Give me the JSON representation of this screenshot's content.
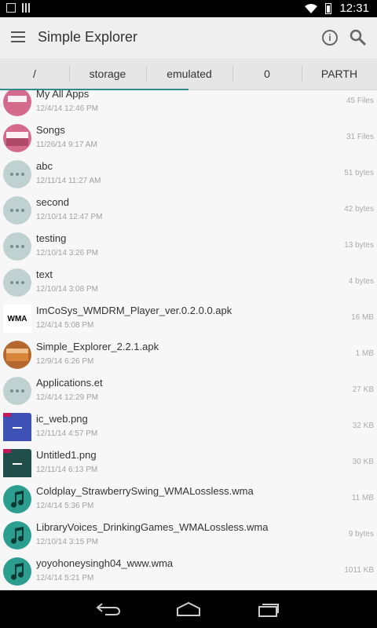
{
  "status_bar": {
    "time": "12:31"
  },
  "app_bar": {
    "title": "Simple Explorer"
  },
  "breadcrumbs": [
    {
      "label": "/",
      "active": true
    },
    {
      "label": "storage"
    },
    {
      "label": "emulated"
    },
    {
      "label": "0"
    },
    {
      "label": "PARTH"
    }
  ],
  "files": [
    {
      "name": "My All Apps",
      "date": "12/4/14 12:46 PM",
      "size": "45 Files",
      "icon": "folder-icon",
      "color": "#d56b8c"
    },
    {
      "name": "Songs",
      "date": "11/26/14 9:17 AM",
      "size": "31 Files",
      "icon": "folder-icon",
      "color": "#d56b8c"
    },
    {
      "name": "abc",
      "date": "12/11/14 11:27 AM",
      "size": "51 bytes",
      "icon": "file-generic-icon",
      "color": "#bfd1d1"
    },
    {
      "name": "second",
      "date": "12/10/14 12:47 PM",
      "size": "42 bytes",
      "icon": "file-generic-icon",
      "color": "#bfd1d1"
    },
    {
      "name": "testing",
      "date": "12/10/14 3:26 PM",
      "size": "13 bytes",
      "icon": "file-generic-icon",
      "color": "#bfd1d1"
    },
    {
      "name": "text",
      "date": "12/10/14 3:08 PM",
      "size": "4 bytes",
      "icon": "file-generic-icon",
      "color": "#bfd1d1"
    },
    {
      "name": "ImCoSys_WMDRM_Player_ver.0.2.0.0.apk",
      "date": "12/4/14 5:08 PM",
      "size": "16 MB",
      "icon": "wma-logo-icon",
      "color": "#ffffff",
      "logo_text": "WMA"
    },
    {
      "name": "Simple_Explorer_2.2.1.apk",
      "date": "12/9/14 6:26 PM",
      "size": "1 MB",
      "icon": "apk-icon",
      "color": "#b5682d"
    },
    {
      "name": "Applications.et",
      "date": "12/4/14 12:29 PM",
      "size": "27 KB",
      "icon": "file-generic-icon",
      "color": "#bfd1d1"
    },
    {
      "name": "ic_web.png",
      "date": "12/11/14 4:57 PM",
      "size": "32 KB",
      "icon": "image-folder-icon",
      "color": "#3f51b5"
    },
    {
      "name": "Untitled1.png",
      "date": "12/11/14 6:13 PM",
      "size": "30 KB",
      "icon": "image-folder-icon",
      "color": "#224e4a"
    },
    {
      "name": "Coldplay_StrawberrySwing_WMALossless.wma",
      "date": "12/4/14 5:36 PM",
      "size": "11 MB",
      "icon": "music-note-icon",
      "color": "#2b9e8f"
    },
    {
      "name": "LibraryVoices_DrinkingGames_WMALossless.wma",
      "date": "12/10/14 3:15 PM",
      "size": "9 bytes",
      "icon": "music-note-icon",
      "color": "#2b9e8f"
    },
    {
      "name": "yoyohoneysingh04_www.wma",
      "date": "12/4/14 5:21 PM",
      "size": "1011 KB",
      "icon": "music-note-icon",
      "color": "#2b9e8f"
    }
  ],
  "colors": {
    "accent": "#2e8b8b"
  }
}
